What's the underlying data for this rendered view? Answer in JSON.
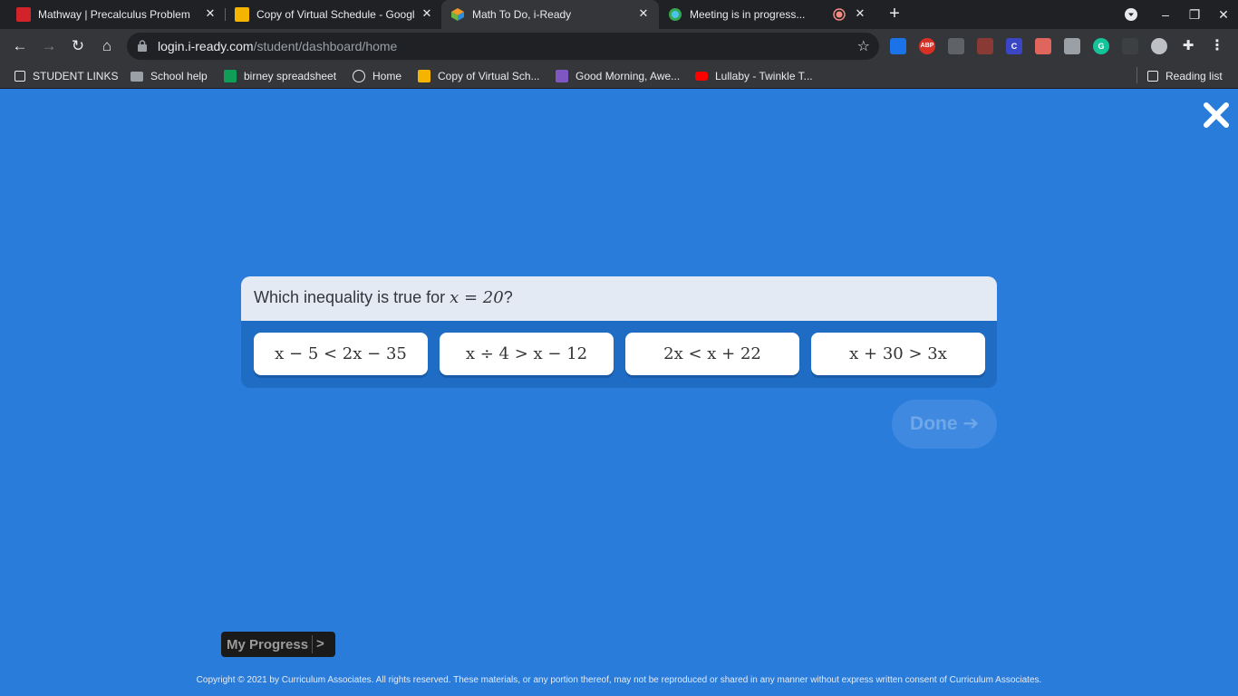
{
  "browser": {
    "tabs": [
      {
        "title": "Mathway | Precalculus Problem",
        "favicon_color": "#d2232a",
        "active": false
      },
      {
        "title": "Copy of Virtual Schedule - Googl",
        "favicon_color": "#f4b400",
        "active": false
      },
      {
        "title": "Math To Do, i-Ready",
        "favicon_color": "#f29a26",
        "active": true
      },
      {
        "title": "Meeting is in progress...",
        "favicon_color": "#34a853",
        "active": false
      }
    ],
    "url_host": "login.i-ready.com",
    "url_path": "/student/dashboard/home",
    "bookmarks": [
      {
        "label": "STUDENT LINKS",
        "icon": "bookmark-list-icon"
      },
      {
        "label": "School help",
        "icon": "folder-icon"
      },
      {
        "label": "birney spreadsheet",
        "icon": "sheets-icon"
      },
      {
        "label": "Home",
        "icon": "s-icon"
      },
      {
        "label": "Copy of Virtual Sch...",
        "icon": "slides-icon"
      },
      {
        "label": "Good Morning, Awe...",
        "icon": "forms-icon"
      },
      {
        "label": "Lullaby - Twinkle T...",
        "icon": "youtube-icon"
      }
    ],
    "reading_list": "Reading list",
    "extensions": [
      "ABP"
    ]
  },
  "lesson": {
    "question_text": "Which inequality is true for ",
    "question_var": "x = 20",
    "question_end": "?",
    "answers": [
      "x − 5 < 2x − 35",
      "x ÷ 4 > x − 12",
      "2x < x + 22",
      "x + 30 > 3x"
    ],
    "done_label": "Done ➔",
    "progress_label": "My Progress",
    "progress_arrow": ">"
  },
  "footer": {
    "copyright": "Copyright © 2021 by Curriculum Associates. All rights reserved. These materials, or any portion thereof, may not be reproduced or shared in any manner without express written consent of Curriculum Associates."
  },
  "colors": {
    "page_bg": "#2a7cdb",
    "card_bg": "#1f6cc4",
    "question_bg": "#e3eaf3"
  }
}
